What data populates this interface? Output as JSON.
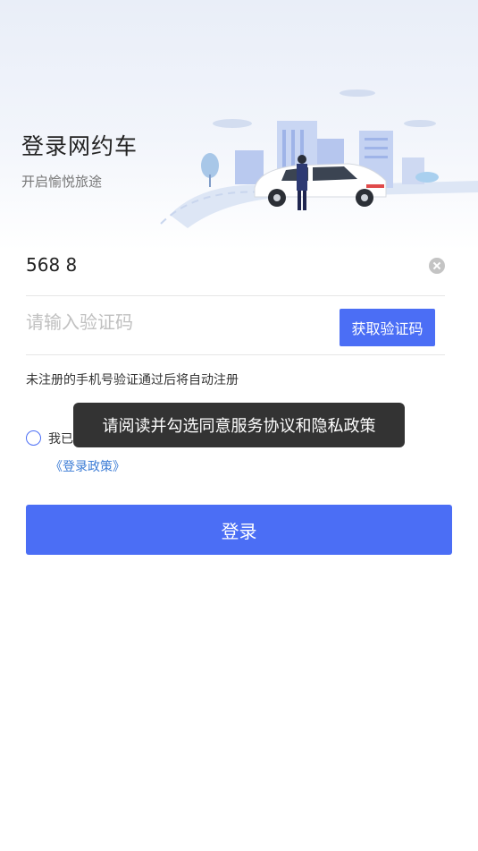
{
  "hero": {
    "title": "登录网约车",
    "subtitle": "开启愉悦旅途"
  },
  "phone": {
    "value": "568 8"
  },
  "code": {
    "placeholder": "请输入验证码",
    "get_code_label": "获取验证码"
  },
  "notice": "未注册的手机号验证通过后将自动注册",
  "agreement": {
    "prefix": "我已",
    "policy_link": "《登录政策》"
  },
  "toast": "请阅读并勾选同意服务协议和隐私政策",
  "login_label": "登录",
  "colors": {
    "accent": "#4b6ef5",
    "link": "#3a7bd5",
    "toast_bg": "#222222"
  }
}
